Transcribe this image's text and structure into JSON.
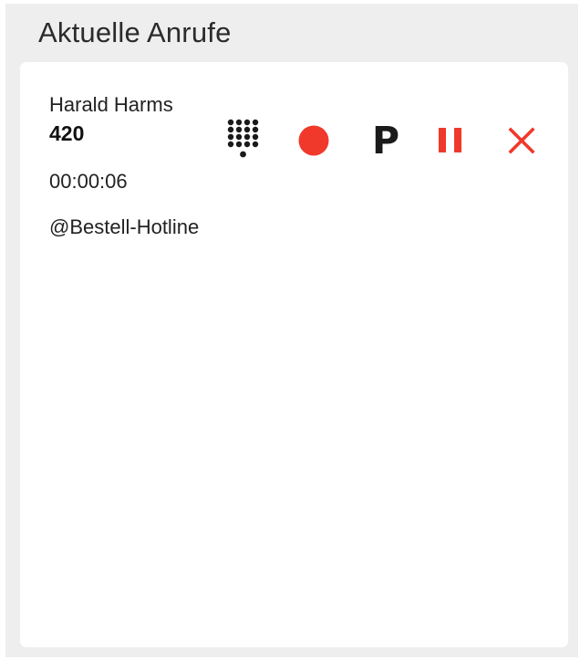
{
  "panel": {
    "title": "Aktuelle Anrufe"
  },
  "call": {
    "caller_name": "Harald Harms",
    "extension": "420",
    "duration": "00:00:06",
    "line": "@Bestell-Hotline"
  },
  "actions": {
    "keypad_icon": "dialpad-icon",
    "record_icon": "record-icon",
    "park_label": "P",
    "hold_icon": "pause-icon",
    "hangup_icon": "close-icon"
  },
  "colors": {
    "accent_red": "#f0392b",
    "panel_bg": "#eeeeee",
    "icon_dark": "#1a1a1a"
  }
}
